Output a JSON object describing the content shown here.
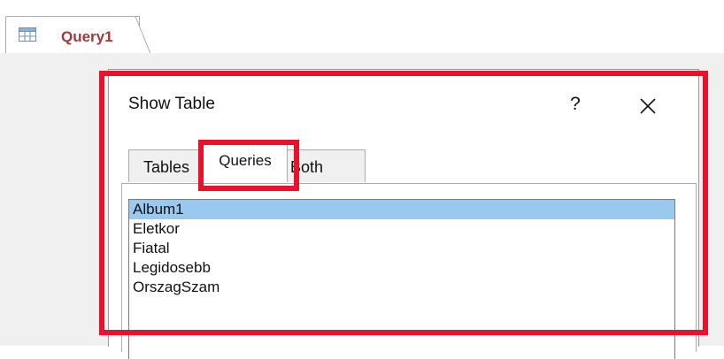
{
  "document_tab": {
    "label": "Query1",
    "icon": "query-icon"
  },
  "dialog": {
    "title": "Show Table",
    "help_label": "?",
    "close_icon": "close-icon",
    "tabs": [
      {
        "label": "Tables",
        "active": false
      },
      {
        "label": "Queries",
        "active": true
      },
      {
        "label": "Both",
        "active": false
      }
    ],
    "list_items": [
      {
        "label": "Album1",
        "selected": true
      },
      {
        "label": "Eletkor",
        "selected": false
      },
      {
        "label": "Fiatal",
        "selected": false
      },
      {
        "label": "Legidosebb",
        "selected": false
      },
      {
        "label": "OrszagSzam",
        "selected": false
      }
    ]
  },
  "colors": {
    "highlight": "#e8132a",
    "selection": "#99c9ef",
    "tab_label": "#a4373a"
  }
}
